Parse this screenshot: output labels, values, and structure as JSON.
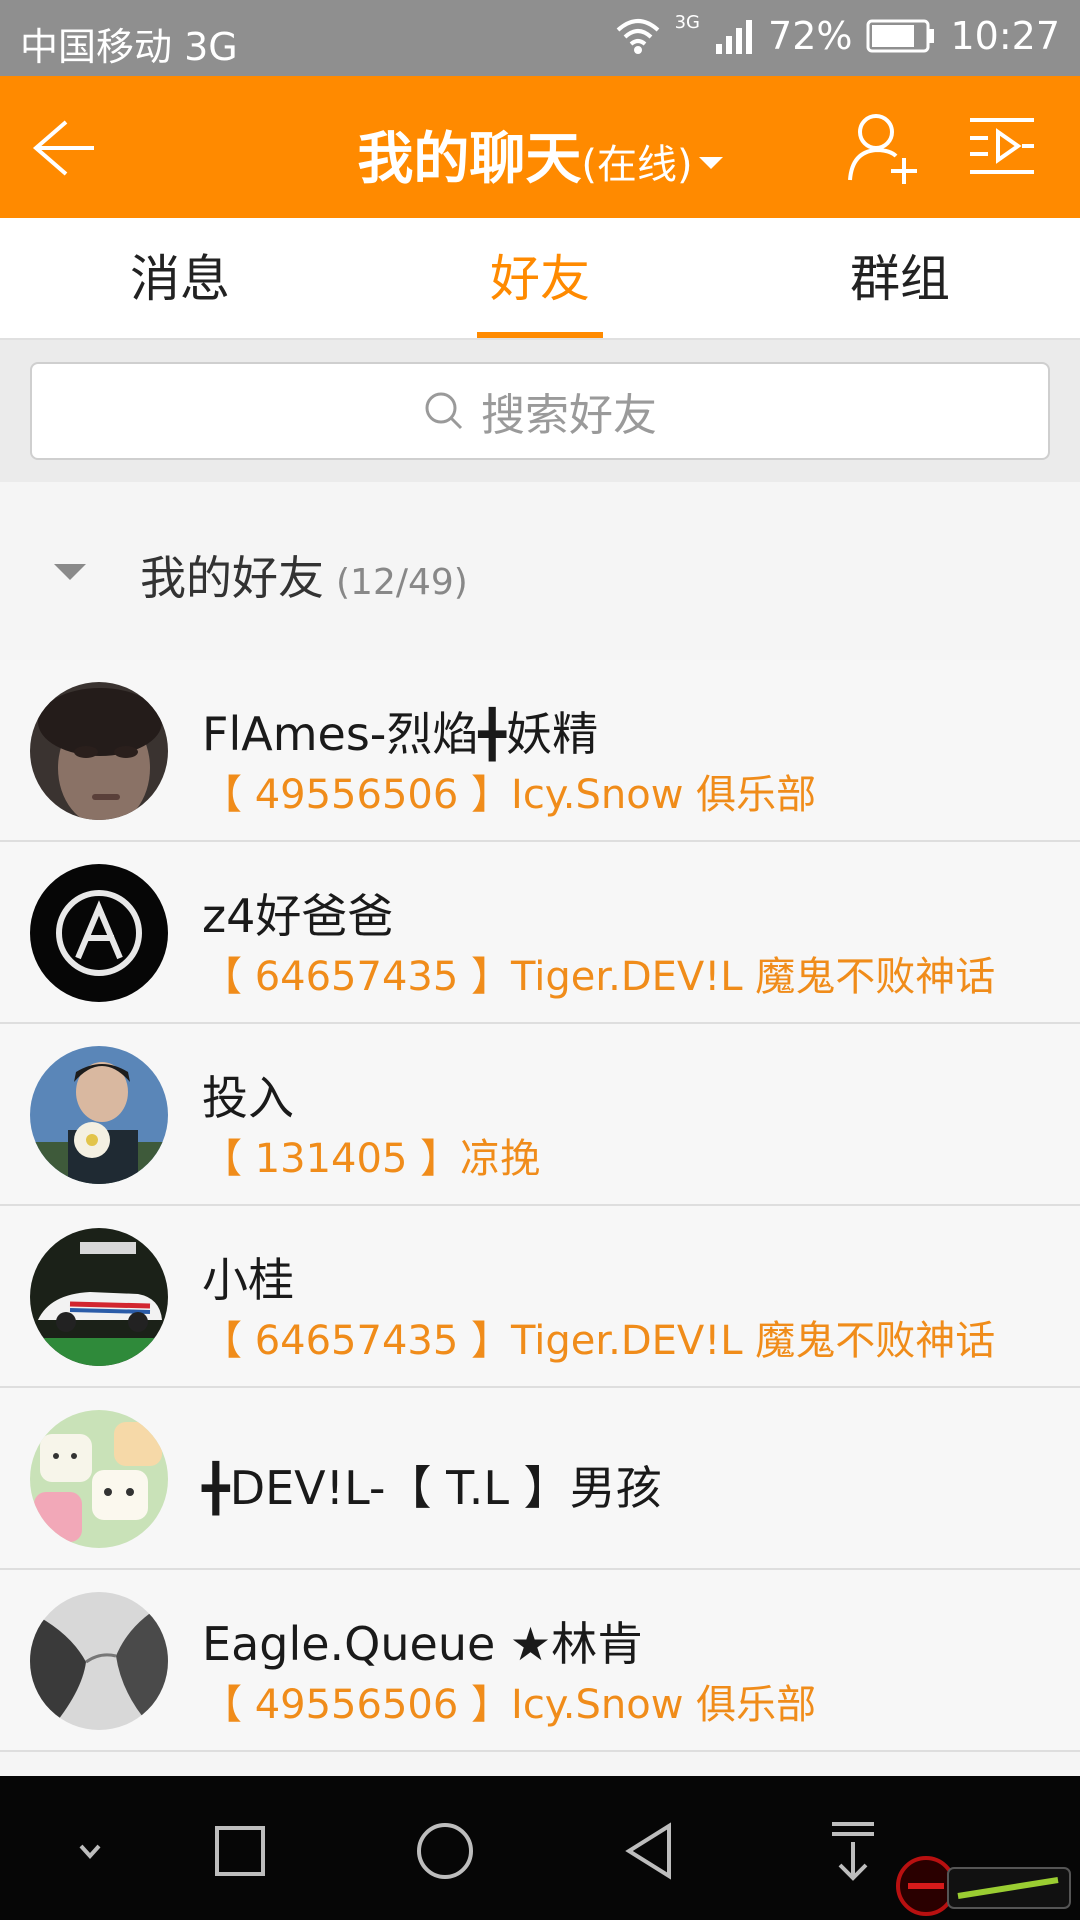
{
  "status_bar": {
    "carrier": "中国移动 3G",
    "network_label": "3G",
    "battery": "72%",
    "time": "10:27"
  },
  "header": {
    "title": "我的聊天",
    "status": "(在线)",
    "icons": [
      "back-arrow-icon",
      "add-friend-icon",
      "menu-icon"
    ]
  },
  "tabs": [
    {
      "label": "消息",
      "active": false
    },
    {
      "label": "好友",
      "active": true
    },
    {
      "label": "群组",
      "active": false
    }
  ],
  "search": {
    "placeholder": "搜索好友"
  },
  "group": {
    "name": "我的好友",
    "count": "(12/49)"
  },
  "friends": [
    {
      "name": "FlAmes-烈焰╋妖精",
      "club": "【 49556506 】Icy.Snow 俱乐部"
    },
    {
      "name": "z4好爸爸",
      "club": "【 64657435 】Tiger.DEV!L 魔鬼不败神话"
    },
    {
      "name": "投入",
      "club": "【 131405 】凉挽"
    },
    {
      "name": "小桂",
      "club": "【 64657435 】Tiger.DEV!L 魔鬼不败神话"
    },
    {
      "name": "╋DEV!L-【 T.L 】男孩",
      "club": ""
    },
    {
      "name": "Eagle.Queue ★林肯",
      "club": "【 49556506 】Icy.Snow 俱乐部"
    }
  ],
  "colors": {
    "accent": "#ff8a00",
    "club_text": "#f08c1a",
    "status_bar": "#8f8f8f",
    "nav_bar": "#060606"
  }
}
